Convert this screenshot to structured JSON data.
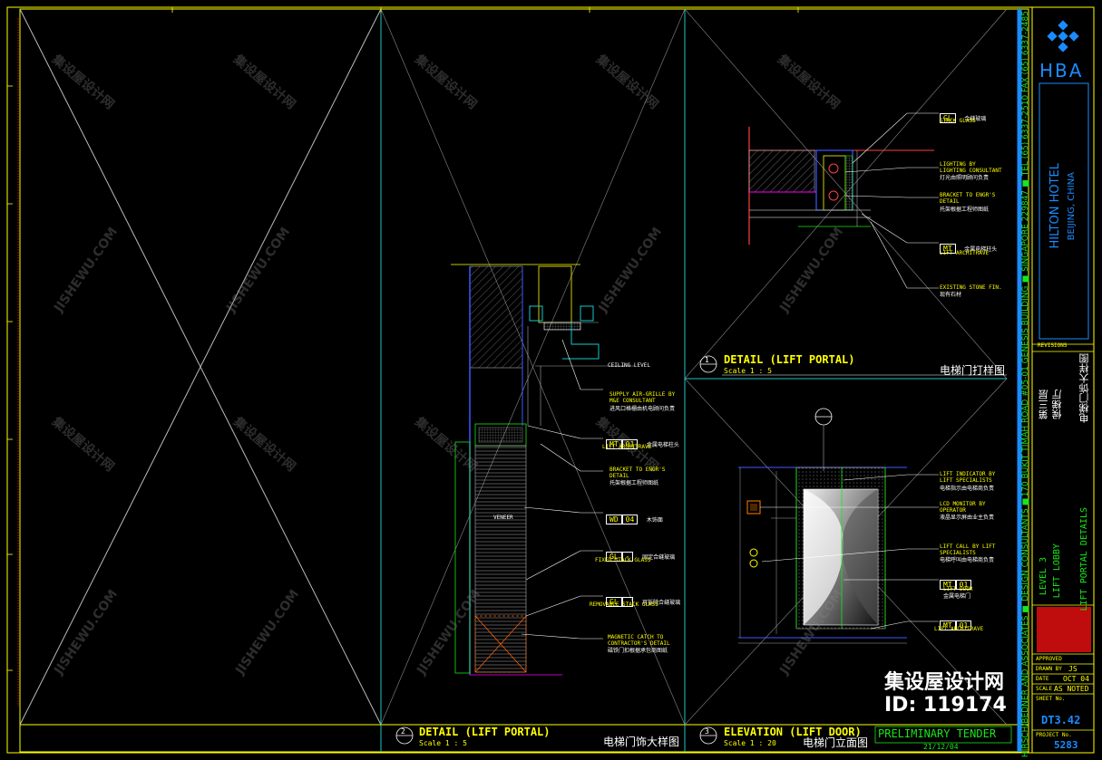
{
  "title_block": {
    "logo_text": "HBA",
    "project_name": "HILTON HOTEL",
    "project_location": "BEIJING, CHINA",
    "consultant_line": "HIRSCH/BEDNER AND ASSOCIATES  ■ DESIGN CONSULTANTS  ■170 BUKIT TIMAH ROAD #05-01 GENESIS BUILDING ■ SINGAPORE 229847 ■ TEL (65) 6337-2510 FAX (65) 6337-2485",
    "revisions_label": "REVISIONS",
    "level": "LEVEL 3",
    "area": "LIFT LOBBY",
    "sheet_title": "LIFT PORTAL DETAILS",
    "level_cn": "第三层",
    "area_cn": "候梯厅",
    "sheet_title_cn": "电梯门饰大样图",
    "approved_label": "APPROVED",
    "drawn_by_label": "DRAWN BY",
    "drawn_by": "JS",
    "date_label": "DATE",
    "date": "OCT 04",
    "scale_label": "SCALE",
    "scale": "AS NOTED",
    "sheet_no_label": "SHEET No.",
    "sheet_no": "DT3.42",
    "project_no_label": "PROJECT No.",
    "project_no": "5283",
    "stamp_label": "PRELIMINARY TENDER",
    "stamp_date": "21/12/04"
  },
  "watermark": {
    "brand_cn": "集设屋设计网",
    "site": "JISHEWU.COM",
    "id_label": "ID: 119174"
  },
  "details": {
    "d1": {
      "num": "1",
      "title": "DETAIL (LIFT PORTAL)",
      "scale": "Scale 1 : 5",
      "title_cn": "电梯门打样图",
      "notes": [
        {
          "tag": "GL",
          "en": "STACK GLASS",
          "cn": "合缝玻璃"
        },
        {
          "en": "LIGHTING BY LIGHTING CONSULTANT",
          "cn": "灯光由照明顾问负责"
        },
        {
          "en": "BRACKET TO ENGR'S DETAIL",
          "cn": "托架根据工程师图纸"
        },
        {
          "tag": "MT",
          "en": "LIFT ARCHITRAVE",
          "cn": "金属电梯柱头"
        },
        {
          "en": "EXISTING STONE FIN.",
          "cn": "现有石材"
        }
      ]
    },
    "d2": {
      "num": "2",
      "title": "DETAIL (LIFT PORTAL)",
      "scale": "Scale 1 : 5",
      "title_cn": "电梯门饰大样图",
      "notes": [
        {
          "en": "SUPPLY AIR-GRILLE BY M&E CONSULTANT",
          "cn": "进风口格栅由机电顾问负责"
        },
        {
          "tag": "MT",
          "num": "01",
          "en": "LIFT ARCHITRAVE",
          "cn": "金属电梯柱头"
        },
        {
          "en": "BRACKET TO ENGR'S DETAIL",
          "cn": "托架根据工程师图纸"
        },
        {
          "tag": "WD",
          "num": "04",
          "en": "",
          "cn": "木饰面"
        },
        {
          "tag": "GL",
          "num": "-",
          "en": "FIXED STACK GLASS",
          "cn": "固定合缝玻璃"
        },
        {
          "tag": "GL",
          "num": "-",
          "en": "REMOVABLE STACK GLASS",
          "cn": "可拆除合缝玻璃"
        },
        {
          "en": "MAGNETIC CATCH TO CONTRACTOR'S DETAIL",
          "cn": "磁铁门扣根据承包商图纸"
        }
      ],
      "veneer_label": "VENEER",
      "ceiling_label": "CEILING LEVEL"
    },
    "d3": {
      "num": "3",
      "title": "ELEVATION (LIFT DOOR)",
      "scale": "Scale 1 : 20",
      "title_cn": "电梯门立面图",
      "notes": [
        {
          "en": "LIFT INDICATOR BY LIFT SPECIALISTS",
          "cn": "电梯指示由电梯商负责"
        },
        {
          "en": "LCD MONITOR BY OPERATOR",
          "cn": "液晶显示屏由业主负责"
        },
        {
          "en": "LIFT CALL BY LIFT SPECIALISTS",
          "cn": "电梯呼叫由电梯商负责"
        },
        {
          "tag": "MT",
          "num": "01",
          "en": "LIFT DOOR",
          "cn": "金属电梯门"
        },
        {
          "tag": "MT",
          "num": "01",
          "en": "LIFT ARCHITRAVE",
          "cn": ""
        }
      ]
    }
  },
  "colors": {
    "frame": "#ffff00",
    "divider": "#19c8c8",
    "accent": "#1a8cff",
    "text": "#ffff00"
  }
}
